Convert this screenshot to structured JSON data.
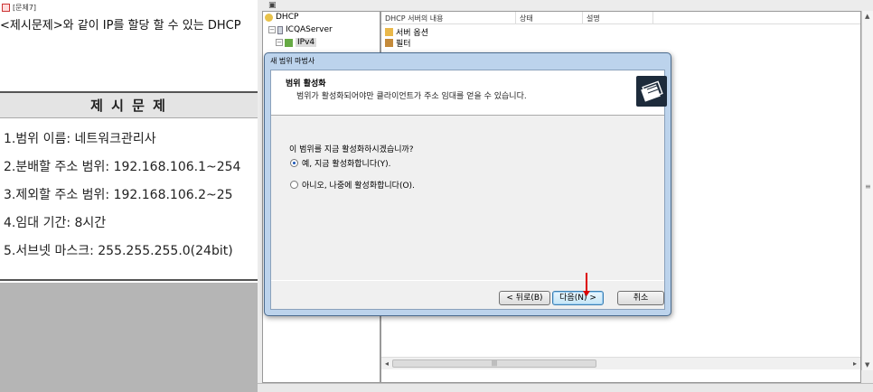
{
  "left": {
    "window_title": "[문제7]",
    "question": "<제시문제>와 같이 IP를 할당 할 수 있는 DHCP",
    "problem_header": "제 시 문 제",
    "problems": [
      "1.범위 이름: 네트워크관리사",
      "2.분배할 주소 범위: 192.168.106.1~254",
      "3.제외할 주소 범위: 192.168.106.2~25",
      "4.임대 기간: 8시간",
      "5.서브넷 마스크: 255.255.255.0(24bit)"
    ]
  },
  "mmc": {
    "tree": {
      "root": "DHCP",
      "server": "ICQAServer",
      "ipv4": "IPv4"
    },
    "columns": {
      "name": "DHCP 서버의 내용",
      "status": "상태",
      "description": "설명"
    },
    "rows": [
      "서버 옵션",
      "필터"
    ]
  },
  "wizard": {
    "title": "새 범위 마법사",
    "header_title": "범위 활성화",
    "header_desc": "범위가 활성화되어야만 클라이언트가 주소 임대를 얻을 수 있습니다.",
    "question": "이 범위를 지금 활성화하시겠습니까?",
    "option_yes": "예, 지금 활성화합니다(Y).",
    "option_no": "아니오, 나중에 활성화합니다(O).",
    "selected": "yes",
    "buttons": {
      "back": "< 뒤로(B)",
      "next": "다음(N) >",
      "cancel": "취소"
    }
  },
  "colors": {
    "annotation_arrow": "#dd0000",
    "dialog_frame": "#bcd3ec"
  }
}
